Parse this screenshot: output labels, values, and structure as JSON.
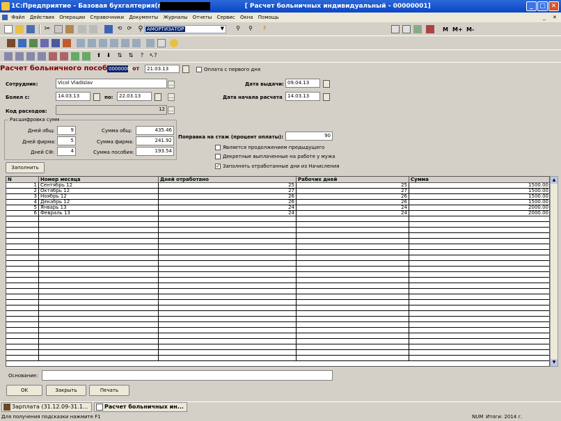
{
  "window": {
    "title": "1С:Предприятие - Базовая бухгалтерия(проф.):",
    "doc_title": "[ Расчет больничных индивидуальный - 00000001]"
  },
  "menu": [
    "Файл",
    "Действия",
    "Операции",
    "Справочники",
    "Документы",
    "Журналы",
    "Отчеты",
    "Сервис",
    "Окна",
    "Помощь"
  ],
  "toolbar": {
    "combo_value": "АМОРТИЗАТОР",
    "m_buttons": [
      "M",
      "M+",
      "M-"
    ]
  },
  "form": {
    "title": "Расчет больничного пособия",
    "number": "00000001",
    "from_label": "от",
    "date": "21.03.13",
    "pay_first_day": "Оплата с первого дня",
    "employee_label": "Сотрудник:",
    "employee": "Vicol Vladislav",
    "sick_from_label": "Болел с:",
    "sick_from": "14.03.13",
    "to_label": "по:",
    "sick_to": "22.03.13",
    "expense_code_label": "Код расходов:",
    "expense_code": "12",
    "issue_date_label": "Дата выдачи:",
    "issue_date": "09.04.13",
    "calc_start_label": "Дата начала расчета",
    "calc_start": "14.03.13",
    "breakdown_label": "Расшифровка сумм",
    "days_total_label": "Дней общ:",
    "days_total": "9",
    "days_firm_label": "Дней фирма:",
    "days_firm": "5",
    "days_sf_label": "Дней СФ:",
    "days_sf": "4",
    "sum_total_label": "Сумма общ:",
    "sum_total": "435.46",
    "sum_firm_label": "Сумма фирма:",
    "sum_firm": "241.92",
    "sum_benefit_label": "Сумма пособия:",
    "sum_benefit": "193.54",
    "seniority_label": "Поправка на стаж (процент оплаты):",
    "seniority": "90",
    "opt1": "Является продолжением предыдущего",
    "opt2": "Декретные выплаченные на работе у мужа",
    "opt3": "Заполнять отработанные дни из Начисления",
    "fill_button": "Заполнить",
    "basis_label": "Основание:",
    "basis": "",
    "ok_button": "OK",
    "close_button": "Закрыть",
    "print_button": "Печать"
  },
  "table": {
    "columns": [
      "N",
      "Номер месяца",
      "Дней отработано",
      "Рабочих дней",
      "Сумма"
    ],
    "rows": [
      {
        "n": "1",
        "month": "Сентябрь 12",
        "worked": "25",
        "work_days": "25",
        "sum": "1500.00"
      },
      {
        "n": "2",
        "month": "Октябрь 12",
        "worked": "27",
        "work_days": "27",
        "sum": "1500.00"
      },
      {
        "n": "3",
        "month": "Ноябрь 12",
        "worked": "26",
        "work_days": "26",
        "sum": "1500.00"
      },
      {
        "n": "4",
        "month": "Декабрь 12",
        "worked": "26",
        "work_days": "26",
        "sum": "1500.00"
      },
      {
        "n": "5",
        "month": "Январь 13",
        "worked": "24",
        "work_days": "24",
        "sum": "2000.00"
      },
      {
        "n": "6",
        "month": "Февраль 13",
        "worked": "24",
        "work_days": "24",
        "sum": "2000.00"
      }
    ]
  },
  "taskbar": {
    "item1": "Зарплата (31.12.09-31.1...",
    "item2": "Расчет больничных ин..."
  },
  "status": {
    "hint": "Для получения подсказки нажмите F1",
    "num": "NUM",
    "totals": "Итоги: 2014 г."
  }
}
